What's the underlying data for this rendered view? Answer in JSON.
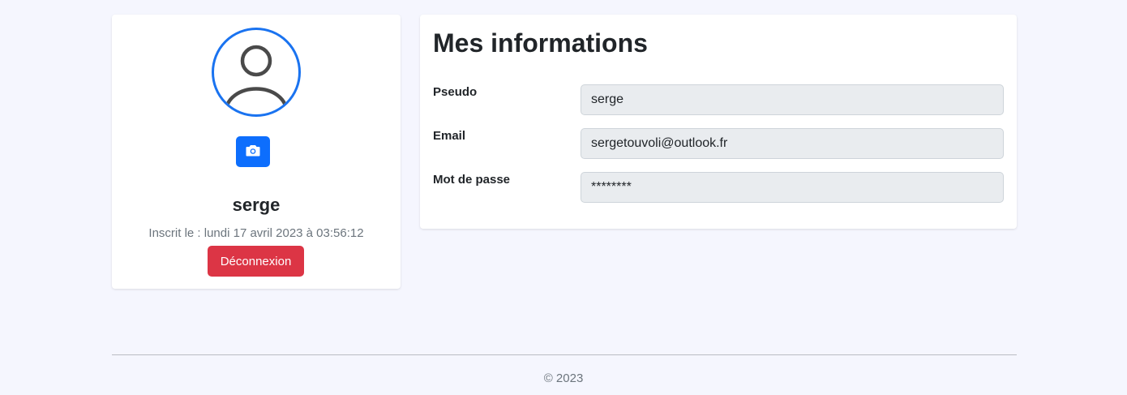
{
  "profile": {
    "avatar_icon": "user-circle-icon",
    "camera_icon": "camera-icon",
    "username": "serge",
    "signup_text": "Inscrit le : lundi 17 avril 2023 à 03:56:12",
    "logout_label": "Déconnexion"
  },
  "info": {
    "title": "Mes informations",
    "fields": [
      {
        "label": "Pseudo",
        "value": "serge"
      },
      {
        "label": "Email",
        "value": "sergetouvoli@outlook.fr"
      },
      {
        "label": "Mot de passe",
        "value": "********"
      }
    ]
  },
  "footer": {
    "copyright": "© 2023"
  },
  "colors": {
    "background": "#f5f6fe",
    "primary": "#0d6efd",
    "avatar_border": "#1a73f0",
    "danger": "#dc3545",
    "input_bg": "#e9ecef",
    "muted_text": "#6c757d"
  }
}
